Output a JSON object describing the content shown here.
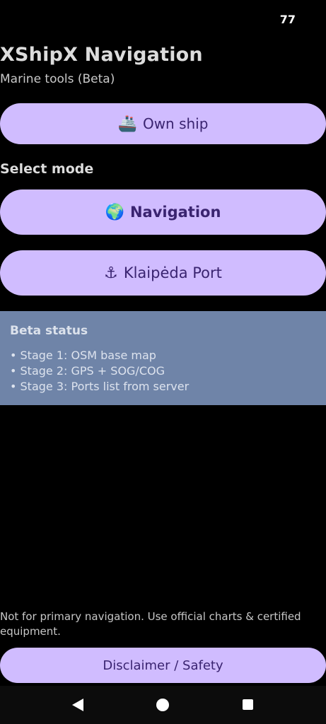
{
  "status_bar": {
    "time": "77"
  },
  "header": {
    "title": "XShipX Navigation",
    "subtitle": "Marine tools (Beta)"
  },
  "own_ship": {
    "icon": "🚢",
    "icon_name": "ship-icon",
    "label": "Own ship"
  },
  "mode_section": {
    "label": "Select mode",
    "buttons": [
      {
        "icon": "🌍",
        "icon_name": "globe-icon",
        "label": "Navigation"
      },
      {
        "icon": "⚓",
        "icon_name": "anchor-icon",
        "label": "Klaipėda Port"
      }
    ]
  },
  "beta_status": {
    "title": "Beta status",
    "items": [
      "• Stage 1: OSM base map",
      "• Stage 2: GPS + SOG/COG",
      "• Stage 3: Ports list from server"
    ]
  },
  "footer": {
    "disclaimer_text": "Not for primary navigation. Use official charts & certified equipment.",
    "disclaimer_button": "Disclaimer / Safety"
  },
  "system_nav": {
    "back": "back-icon",
    "home": "home-icon",
    "recents": "recents-icon"
  },
  "colors": {
    "background": "#000000",
    "button_fill": "#d0bcff",
    "button_text": "#3a2470",
    "beta_panel": "#6f84a8"
  }
}
